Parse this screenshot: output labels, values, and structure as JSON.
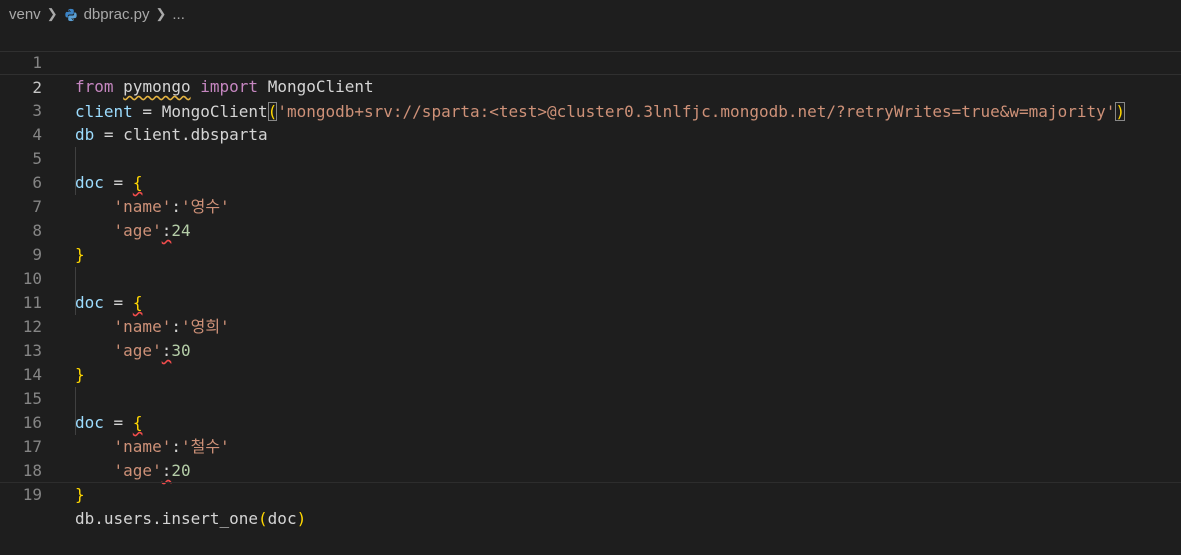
{
  "breadcrumb": {
    "folder": "venv",
    "file": "dbprac.py",
    "more": "..."
  },
  "editor": {
    "current_line": 2,
    "lines": [
      {
        "n": "1"
      },
      {
        "n": "2"
      },
      {
        "n": "3"
      },
      {
        "n": "4"
      },
      {
        "n": "5"
      },
      {
        "n": "6"
      },
      {
        "n": "7"
      },
      {
        "n": "8"
      },
      {
        "n": "9"
      },
      {
        "n": "10"
      },
      {
        "n": "11"
      },
      {
        "n": "12"
      },
      {
        "n": "13"
      },
      {
        "n": "14"
      },
      {
        "n": "15"
      },
      {
        "n": "16"
      },
      {
        "n": "17"
      },
      {
        "n": "18"
      },
      {
        "n": "19"
      }
    ],
    "tokens": {
      "from": "from",
      "pymongo": "pymongo",
      "import": "import",
      "MongoClient": "MongoClient",
      "client": "client",
      "eq": " = ",
      "lparen": "(",
      "rparen": ")",
      "uri": "'mongodb+srv://sparta:<test>@cluster0.3lnlfjc.mongodb.net/?retryWrites=true&w=majority'",
      "db": "db",
      "dbsparta": "client.dbsparta",
      "doc": "doc",
      "lbrace": "{",
      "rbrace": "}",
      "name_key": "'name'",
      "age_key": "'age'",
      "colon": ":",
      "name1": "'영수'",
      "age1": "24",
      "name2": "'영희'",
      "age2": "30",
      "name3": "'철수'",
      "age3": "20",
      "db_users": "db.users.",
      "insert_one": "insert_one",
      "doc_arg": "doc"
    }
  }
}
